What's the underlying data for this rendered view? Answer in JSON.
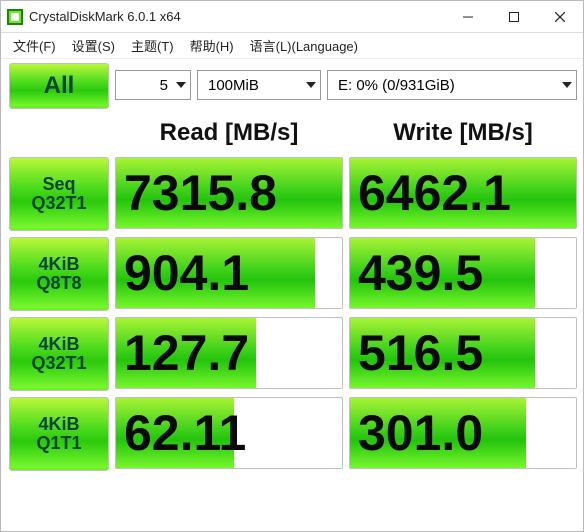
{
  "window": {
    "title": "CrystalDiskMark 6.0.1 x64"
  },
  "menu": {
    "file": "文件(F)",
    "settings": "设置(S)",
    "theme": "主题(T)",
    "help": "帮助(H)",
    "language": "语言(L)(Language)"
  },
  "controls": {
    "all_label": "All",
    "runs_value": "5",
    "size_value": "100MiB",
    "drive_value": "E: 0% (0/931GiB)"
  },
  "headers": {
    "read": "Read [MB/s]",
    "write": "Write [MB/s]"
  },
  "tests": [
    {
      "label_l1": "Seq",
      "label_l2": "Q32T1",
      "read": "7315.8",
      "write": "6462.1",
      "read_bar": 100,
      "write_bar": 100
    },
    {
      "label_l1": "4KiB",
      "label_l2": "Q8T8",
      "read": "904.1",
      "write": "439.5",
      "read_bar": 88,
      "write_bar": 82
    },
    {
      "label_l1": "4KiB",
      "label_l2": "Q32T1",
      "read": "127.7",
      "write": "516.5",
      "read_bar": 62,
      "write_bar": 82
    },
    {
      "label_l1": "4KiB",
      "label_l2": "Q1T1",
      "read": "62.11",
      "write": "301.0",
      "read_bar": 52,
      "write_bar": 78
    }
  ],
  "chart_data": {
    "type": "table",
    "title": "CrystalDiskMark 6.0.1 x64",
    "columns": [
      "Test",
      "Read [MB/s]",
      "Write [MB/s]"
    ],
    "rows": [
      [
        "Seq Q32T1",
        7315.8,
        6462.1
      ],
      [
        "4KiB Q8T8",
        904.1,
        439.5
      ],
      [
        "4KiB Q32T1",
        127.7,
        516.5
      ],
      [
        "4KiB Q1T1",
        62.11,
        301.0
      ]
    ],
    "runs": 5,
    "test_size": "100MiB",
    "drive": "E: 0% (0/931GiB)"
  }
}
